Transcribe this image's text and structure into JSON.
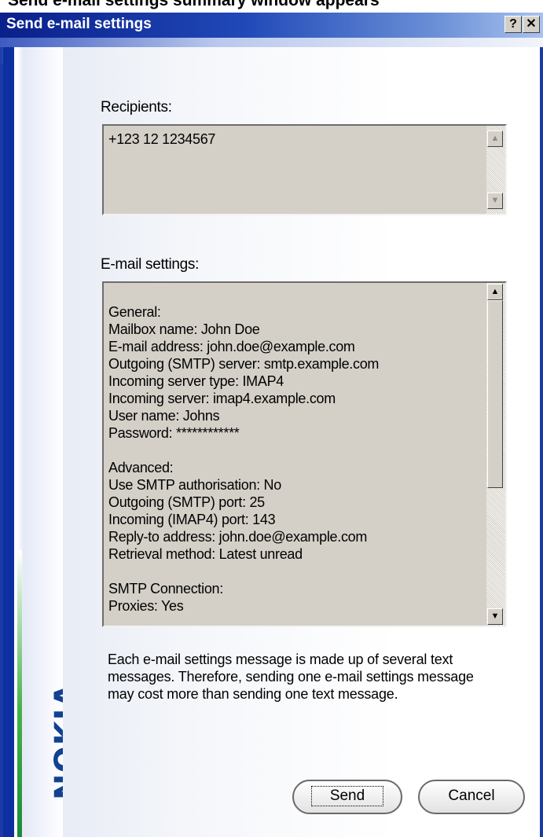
{
  "top_clipped_text": "Send e-mail settings summary window appears",
  "window": {
    "title": "Send e-mail settings",
    "help_glyph": "?",
    "close_glyph": "✕"
  },
  "brand": {
    "logo_text": "NOKIA",
    "accent": "#124191"
  },
  "recipients": {
    "label": "Recipients:",
    "value": "+123 12 1234567"
  },
  "email_settings": {
    "label": "E-mail settings:",
    "lines": [
      "",
      "General:",
      "Mailbox name: John Doe",
      "E-mail address: john.doe@example.com",
      "Outgoing (SMTP) server: smtp.example.com",
      "Incoming server type: IMAP4",
      "Incoming server: imap4.example.com",
      "User name: Johns",
      "Password: ************",
      "",
      "Advanced:",
      "Use SMTP authorisation: No",
      "Outgoing (SMTP) port: 25",
      "Incoming (IMAP4) port: 143",
      "Reply-to address: john.doe@example.com",
      "Retrieval method: Latest unread",
      "",
      "SMTP Connection:",
      "Proxies: Yes"
    ]
  },
  "note": "Each e-mail settings message is made up of several text messages. Therefore, sending one e-mail settings message may cost more than sending one text message.",
  "buttons": {
    "send": "Send",
    "cancel": "Cancel"
  },
  "icons": {
    "scroll_up": "▲",
    "scroll_down": "▼"
  }
}
